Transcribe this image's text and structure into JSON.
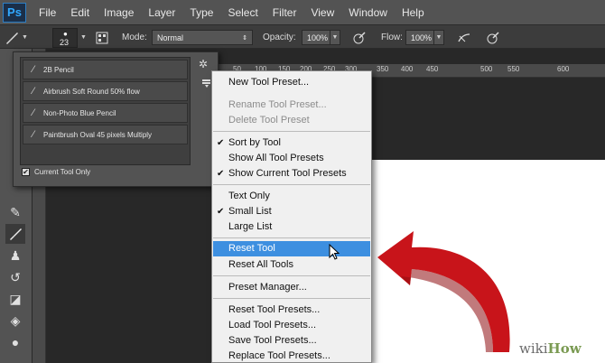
{
  "app": {
    "logo": "Ps"
  },
  "menubar": [
    "File",
    "Edit",
    "Image",
    "Layer",
    "Type",
    "Select",
    "Filter",
    "View",
    "Window",
    "Help"
  ],
  "options": {
    "brush_size": "23",
    "mode_label": "Mode:",
    "mode_value": "Normal",
    "opacity_label": "Opacity:",
    "opacity_value": "100%",
    "flow_label": "Flow:",
    "flow_value": "100%"
  },
  "ruler": {
    "marks": [
      "50",
      "100",
      "150",
      "200",
      "250",
      "300",
      "350",
      "400",
      "450",
      "500",
      "550",
      "600"
    ]
  },
  "presets_panel": {
    "items": [
      {
        "icon": "brush-icon",
        "label": "2B Pencil"
      },
      {
        "icon": "brush-icon",
        "label": "Airbrush Soft Round 50% flow"
      },
      {
        "icon": "brush-icon",
        "label": "Non-Photo Blue Pencil"
      },
      {
        "icon": "brush-icon",
        "label": "Paintbrush Oval 45 pixels Multiply"
      }
    ],
    "current_tool_only": "Current Tool Only",
    "current_tool_only_checked": true
  },
  "flyout_menu": {
    "items": [
      {
        "label": "New Tool Preset...",
        "enabled": true,
        "checked": false
      },
      {
        "label": "Rename Tool Preset...",
        "enabled": false,
        "checked": false
      },
      {
        "label": "Delete Tool Preset",
        "enabled": false,
        "checked": false
      },
      {
        "label": "Sort by Tool",
        "enabled": true,
        "checked": true
      },
      {
        "label": "Show All Tool Presets",
        "enabled": true,
        "checked": false
      },
      {
        "label": "Show Current Tool Presets",
        "enabled": true,
        "checked": true
      },
      {
        "label": "Text Only",
        "enabled": true,
        "checked": false
      },
      {
        "label": "Small List",
        "enabled": true,
        "checked": true
      },
      {
        "label": "Large List",
        "enabled": true,
        "checked": false
      },
      {
        "label": "Reset Tool",
        "enabled": true,
        "checked": false,
        "highlighted": true
      },
      {
        "label": "Reset All Tools",
        "enabled": true,
        "checked": false
      },
      {
        "label": "Preset Manager...",
        "enabled": true,
        "checked": false
      },
      {
        "label": "Reset Tool Presets...",
        "enabled": true,
        "checked": false
      },
      {
        "label": "Load Tool Presets...",
        "enabled": true,
        "checked": false
      },
      {
        "label": "Save Tool Presets...",
        "enabled": true,
        "checked": false
      },
      {
        "label": "Replace Tool Presets...",
        "enabled": true,
        "checked": false
      }
    ],
    "check_glyph": "✔"
  },
  "watermark": {
    "a": "wiki",
    "b": "How"
  },
  "colors": {
    "highlight": "#3d8fe0",
    "arrow": "#c8141a",
    "ps_blue": "#31a8ff"
  }
}
